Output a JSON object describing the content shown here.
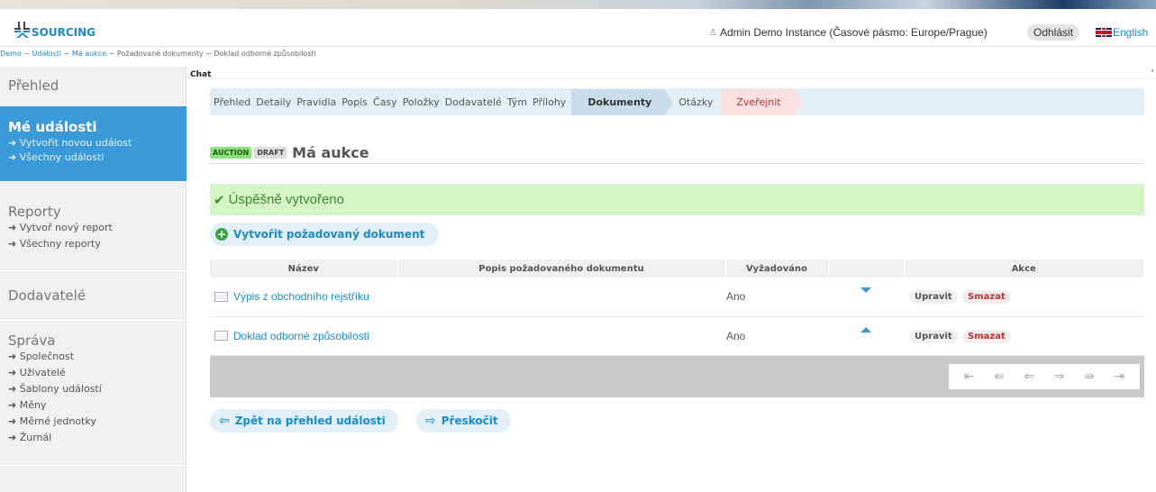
{
  "brand": {
    "name": "SOURCING"
  },
  "header": {
    "user": "Admin Demo Instance (Časové pásmo: Europe/Prague)",
    "logout": "Odhlásit",
    "language": "English"
  },
  "breadcrumb": {
    "items": [
      "Demo",
      "Události",
      "Má aukce"
    ],
    "rest": "~ Požadované dokumenty ~ Doklad odborné způsobilosti",
    "sep": "~"
  },
  "chat": {
    "label": "Chat",
    "arrow": "›"
  },
  "sidebar": {
    "overview": "Přehled",
    "my_events": {
      "title": "Mé události",
      "links": [
        "Vytvořit novou událost",
        "Všechny události"
      ]
    },
    "reports": {
      "title": "Reporty",
      "links": [
        "Vytvoř nový report",
        "Všechny reporty"
      ]
    },
    "suppliers": "Dodavatelé",
    "admin": {
      "title": "Správa",
      "links": [
        "Společnost",
        "Uživatelé",
        "Šablony událostí",
        "Měny",
        "Měrné jednotky",
        "Žurnál"
      ]
    }
  },
  "tabs": [
    "Přehled",
    "Detaily",
    "Pravidla",
    "Popis",
    "Časy",
    "Položky",
    "Dodavatelé",
    "Tým",
    "Přílohy"
  ],
  "tab_active": "Dokumenty",
  "tab_after": "Otázky",
  "tab_publish": "Zveřejnit",
  "event": {
    "badge_type": "AUCTION",
    "badge_status": "DRAFT",
    "title": "Má aukce"
  },
  "success_message": "Úspěšně vytvořeno",
  "create_button": "Vytvořit požadovaný dokument",
  "table": {
    "headers": [
      "Název",
      "Popis požadovaného dokumentu",
      "Vyžadováno",
      "",
      "Akce"
    ],
    "rows": [
      {
        "name": "Výpis z obchodního rejstříku",
        "description": "",
        "required": "Ano",
        "move": "down",
        "edit": "Upravit",
        "delete": "Smazat"
      },
      {
        "name": "Doklad odborné způsobilosti",
        "description": "",
        "required": "Ano",
        "move": "up",
        "edit": "Upravit",
        "delete": "Smazat"
      }
    ]
  },
  "bottom": {
    "back": "Zpět na přehled události",
    "skip": "Přeskočit"
  },
  "colors": {
    "accent": "#1a8ccc",
    "sidebar_active": "#3a9ad9",
    "success_bg": "#d6f5c7"
  }
}
